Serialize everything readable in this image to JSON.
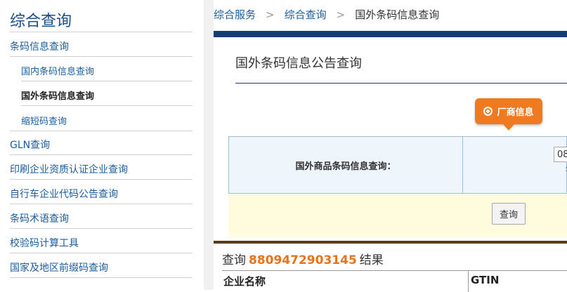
{
  "sidebar": {
    "title": "综合查询",
    "items": [
      {
        "label": "条码信息查询"
      },
      {
        "label": "国内条码信息查询"
      },
      {
        "label": "国外条码信息查询"
      },
      {
        "label": "缩短码查询"
      },
      {
        "label": "GLN查询"
      },
      {
        "label": "印刷企业资质认证企业查询"
      },
      {
        "label": "自行车企业代码公告查询"
      },
      {
        "label": "条码术语查询"
      },
      {
        "label": "校验码计算工具"
      },
      {
        "label": "国家及地区前缀码查询"
      }
    ]
  },
  "breadcrumb": {
    "items": [
      "综合服务",
      "综合查询",
      "国外条码信息查询"
    ],
    "separator": ">"
  },
  "panel": {
    "title": "国外条码信息公告查询",
    "tag_label": "厂商信息",
    "query_label": "国外商品条码信息查询：",
    "input_value": "08",
    "submit_label": "查询"
  },
  "result": {
    "prefix": "查询",
    "code": "8809472903145",
    "suffix": "结果",
    "columns": [
      "企业名称",
      "GTIN"
    ]
  },
  "colors": {
    "accent": "#f07a1f",
    "nav": "#1a5c9e",
    "header_bar": "#173e72"
  }
}
